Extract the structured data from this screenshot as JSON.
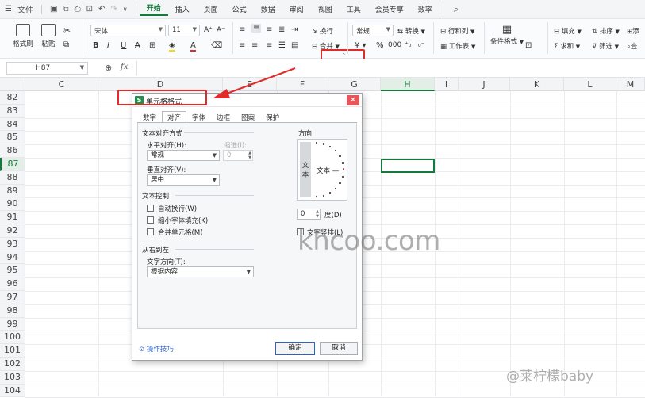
{
  "menubar": {
    "file": "文件",
    "tabs": [
      "开始",
      "插入",
      "页面",
      "公式",
      "数据",
      "审阅",
      "视图",
      "工具",
      "会员专享",
      "效率"
    ],
    "active_tab": "开始"
  },
  "ribbon": {
    "format_painter": "格式刷",
    "paste": "粘贴",
    "font_name": "宋体",
    "font_size": "11",
    "wrap": "换行",
    "merge": "合并",
    "number_format": "常规",
    "convert": "转换",
    "row_col": "行和列",
    "worksheet": "工作表",
    "cond_format": "条件格式",
    "fill": "填充",
    "sort": "排序",
    "sum": "求和",
    "filter": "筛选",
    "add_partial": "添",
    "find_partial": "查"
  },
  "formula_bar": {
    "cell_ref": "H87",
    "fx": "fx"
  },
  "grid": {
    "columns": [
      "C",
      "D",
      "E",
      "F",
      "G",
      "H",
      "I",
      "J",
      "K",
      "L",
      "M"
    ],
    "selected_column": "H",
    "rows": [
      "82",
      "83",
      "84",
      "85",
      "86",
      "87",
      "88",
      "89",
      "90",
      "91",
      "92",
      "93",
      "94",
      "95",
      "96",
      "97",
      "98",
      "99",
      "100",
      "101",
      "102",
      "103",
      "104"
    ],
    "selected_row": "87"
  },
  "dialog": {
    "title": "单元格格式",
    "tabs": [
      "数字",
      "对齐",
      "字体",
      "边框",
      "图案",
      "保护"
    ],
    "active_tab": "对齐",
    "text_alignment_group": "文本对齐方式",
    "horizontal_label": "水平对齐(H):",
    "horizontal_value": "常规",
    "indent_label": "缩进(I):",
    "indent_value": "0",
    "vertical_label": "垂直对齐(V):",
    "vertical_value": "居中",
    "text_control_group": "文本控制",
    "wrap_text": "自动换行(W)",
    "shrink_to_fit": "缩小字体填充(K)",
    "merge_cells": "合并单元格(M)",
    "rtl_group": "从右到左",
    "text_direction_label": "文字方向(T):",
    "text_direction_value": "根据内容",
    "orientation_group": "方向",
    "vertical_text": "文本",
    "orient_text": "文本 —",
    "degree_value": "0",
    "degree_label": "度(D)",
    "vertical_layout": "文字竖排(L)",
    "tips": "操作技巧",
    "ok": "确定",
    "cancel": "取消"
  },
  "watermark": "khcoo.com",
  "corner_watermark": "@莱柠檬baby",
  "colors": {
    "accent": "#157a3b",
    "highlight": "#e02b2b"
  }
}
